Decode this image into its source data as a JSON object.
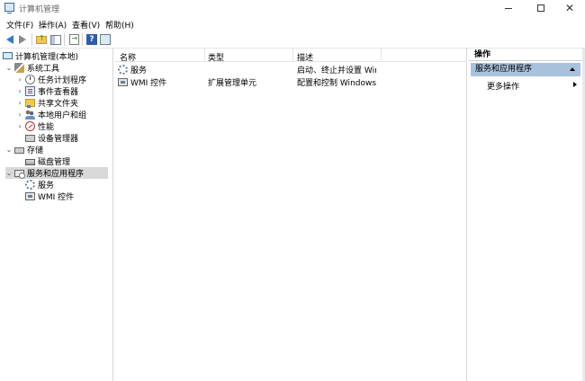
{
  "window": {
    "title": "计算机管理",
    "minimize_icon": "minimize-icon",
    "maximize_icon": "maximize-icon",
    "close_icon": "close-icon"
  },
  "menu": [
    "文件(F)",
    "操作(A)",
    "查看(V)",
    "帮助(H)"
  ],
  "toolbar": [
    "back-arrow-icon",
    "forward-arrow-icon",
    "up-folder-icon",
    "show-hide-tree-icon",
    "export-list-icon",
    "help-icon",
    "view-icon"
  ],
  "tree": {
    "root": "计算机管理(本地)",
    "system_tools": "系统工具",
    "task_scheduler": "任务计划程序",
    "event_viewer": "事件查看器",
    "shared_folders": "共享文件夹",
    "local_users": "本地用户和组",
    "performance": "性能",
    "device_manager": "设备管理器",
    "storage": "存储",
    "disk_management": "磁盘管理",
    "services_apps": "服务和应用程序",
    "services": "服务",
    "wmi": "WMI 控件"
  },
  "list": {
    "columns": [
      "名称",
      "类型",
      "描述"
    ],
    "rows": [
      {
        "name": "服务",
        "type": "",
        "desc": "启动、终止并设置 Win..."
      },
      {
        "name": "WMI 控件",
        "type": "扩展管理单元",
        "desc": "配置和控制 Windows ..."
      }
    ]
  },
  "actions": {
    "header": "操作",
    "section": "服务和应用程序",
    "more": "更多操作"
  }
}
